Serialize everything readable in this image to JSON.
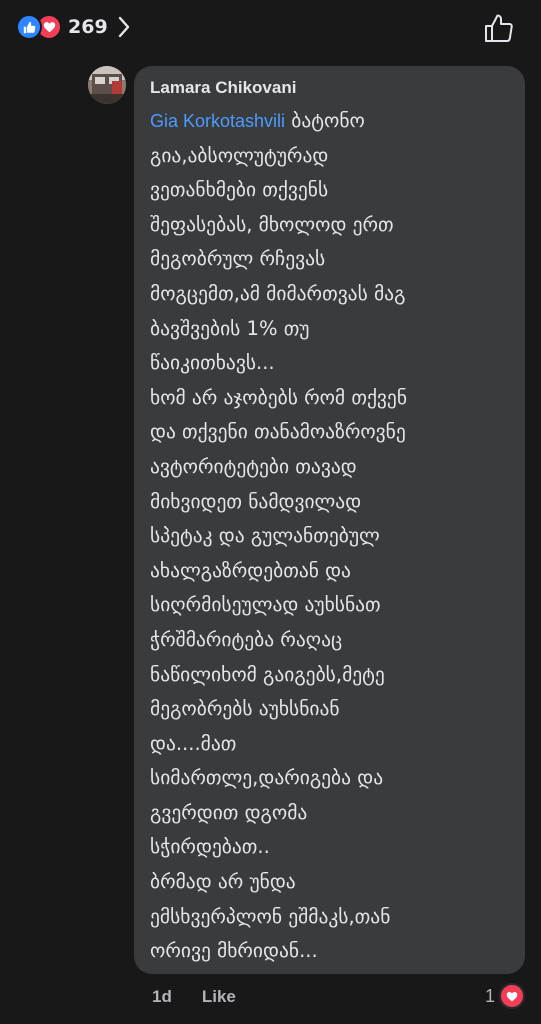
{
  "reactions": {
    "count": "269",
    "types": [
      "like-icon",
      "love-icon"
    ]
  },
  "comment": {
    "author": "Lamara Chikovani",
    "mention": "Gia Korkotashvili",
    "lines": [
      " ბატონო",
      "გია,აბსოლუტურად",
      "ვეთანხმები თქვენს",
      "შეფასებას, მხოლოდ ერთ",
      "მეგობრულ რჩევას",
      "მოგცემთ,ამ მიმართვას მაგ",
      "ბავშვების 1% თუ",
      "წაიკითხავს...",
      "ხომ არ აჯობებს რომ თქვენ",
      "და თქვენი თანამოაზროვნე",
      "ავტორიტეტები თავად",
      "მიხვიდეთ ნამდვილად",
      "სპეტაკ და გულანთებულ",
      "ახალგაზრდებთან და",
      "სიღრმისეულად აუხსნათ",
      "ჭრშმარიტება რაღაც",
      "ნაწილიხომ გაიგებს,მეტე",
      "მეგობრებს აუხსნიან",
      "და....მათ",
      "სიმართლე,დარიგება და",
      "გვერდით დგომა",
      "სჭირდებათ..",
      "ბრმად არ უნდა",
      "ემსხვერპლონ ეშმაკს,თან",
      "ორივე მხრიდან..."
    ],
    "time": "1d",
    "like_label": "Like",
    "reaction_count": "1"
  },
  "colors": {
    "background": "#181819",
    "bubble": "#3a3b3c",
    "mention": "#4c9bff",
    "like_blue": "#2d86ff",
    "love_red": "#f33e58",
    "secondary_text": "#b0b3b8"
  }
}
